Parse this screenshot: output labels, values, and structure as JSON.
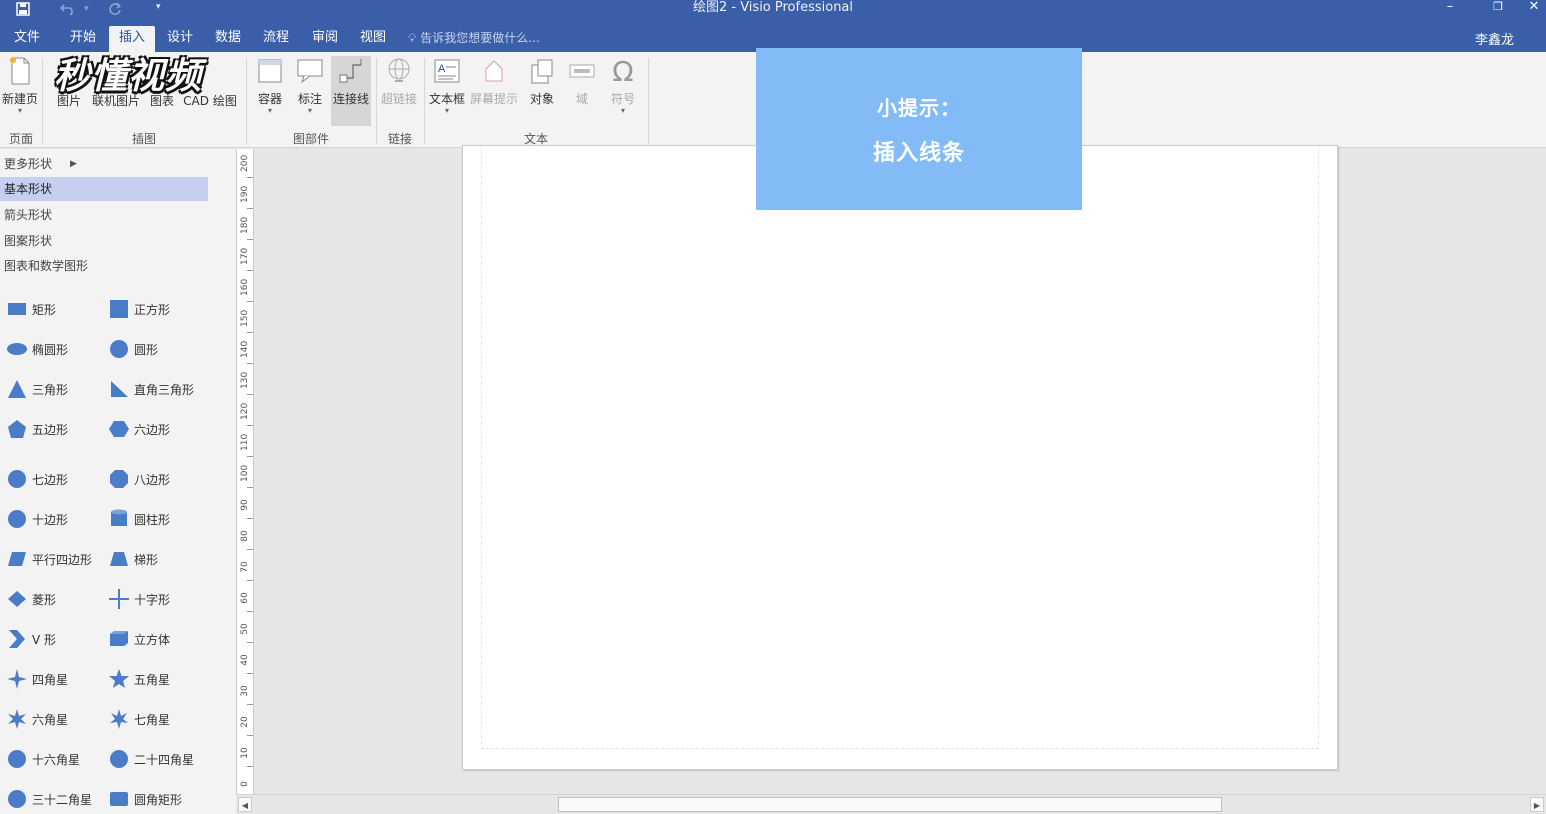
{
  "app": {
    "title": "绘图2 - Visio Professional",
    "accent_color": "#3a5ea8",
    "user": "李鑫龙"
  },
  "quick_access": {
    "save_icon": "save-icon",
    "undo_icon": "undo-icon",
    "redo_icon": "redo-icon",
    "customize_icon": "customize-qat-icon"
  },
  "tabs": [
    {
      "label": "文件"
    },
    {
      "label": "开始"
    },
    {
      "label": "插入",
      "active": true
    },
    {
      "label": "设计"
    },
    {
      "label": "数据"
    },
    {
      "label": "流程"
    },
    {
      "label": "审阅"
    },
    {
      "label": "视图"
    }
  ],
  "tell_me": "告诉我您想要做什么...",
  "ribbon": {
    "buttons": {
      "new_page": "新建页",
      "picture": "图片",
      "online_picture": "联机图片",
      "chart": "图表",
      "cad_drawing": "CAD 绘图",
      "container": "容器",
      "callout": "标注",
      "connector": "连接线",
      "hyperlink": "超链接",
      "textbox": "文本框",
      "screentip": "屏幕提示",
      "object": "对象",
      "field": "域",
      "symbol": "符号"
    },
    "groups": {
      "pages": "页面",
      "illustrations": "插图",
      "diagram_parts": "图部件",
      "links": "链接",
      "text": "文本"
    }
  },
  "watermark": "秒懂视频",
  "tip": {
    "line1": "小提示：",
    "line2": "插入线条"
  },
  "shapes_pane": {
    "categories": [
      {
        "label": "更多形状"
      },
      {
        "label": "基本形状",
        "selected": true
      },
      {
        "label": "箭头形状"
      },
      {
        "label": "图案形状"
      },
      {
        "label": "图表和数学图形"
      }
    ],
    "shape_color": "#4a7cc8",
    "shapes": [
      {
        "label": "矩形",
        "icon": "rectangle-icon"
      },
      {
        "label": "正方形",
        "icon": "square-icon"
      },
      {
        "label": "椭圆形",
        "icon": "ellipse-icon"
      },
      {
        "label": "圆形",
        "icon": "circle-icon"
      },
      {
        "label": "三角形",
        "icon": "triangle-icon"
      },
      {
        "label": "直角三角形",
        "icon": "right-triangle-icon"
      },
      {
        "label": "五边形",
        "icon": "pentagon-icon"
      },
      {
        "label": "六边形",
        "icon": "hexagon-icon"
      },
      {
        "label": "七边形",
        "icon": "heptagon-icon"
      },
      {
        "label": "八边形",
        "icon": "octagon-icon"
      },
      {
        "label": "十边形",
        "icon": "decagon-icon"
      },
      {
        "label": "圆柱形",
        "icon": "cylinder-icon"
      },
      {
        "label": "平行四边形",
        "icon": "parallelogram-icon"
      },
      {
        "label": "梯形",
        "icon": "trapezoid-icon"
      },
      {
        "label": "菱形",
        "icon": "diamond-icon"
      },
      {
        "label": "十字形",
        "icon": "cross-icon"
      },
      {
        "label": "V 形",
        "icon": "chevron-icon"
      },
      {
        "label": "立方体",
        "icon": "cube-icon"
      },
      {
        "label": "四角星",
        "icon": "star4-icon"
      },
      {
        "label": "五角星",
        "icon": "star5-icon"
      },
      {
        "label": "六角星",
        "icon": "star6-icon"
      },
      {
        "label": "七角星",
        "icon": "star7-icon"
      },
      {
        "label": "十六角星",
        "icon": "star16-icon"
      },
      {
        "label": "二十四角星",
        "icon": "star24-icon"
      },
      {
        "label": "三十二角星",
        "icon": "star32-icon"
      },
      {
        "label": "圆角矩形",
        "icon": "rounded-rectangle-icon"
      }
    ]
  },
  "ruler": {
    "labels": [
      "200",
      "190",
      "180",
      "170",
      "160",
      "150",
      "140",
      "130",
      "120",
      "110",
      "100",
      "90",
      "80",
      "70",
      "60",
      "50",
      "40",
      "30",
      "20",
      "10",
      "0"
    ]
  }
}
